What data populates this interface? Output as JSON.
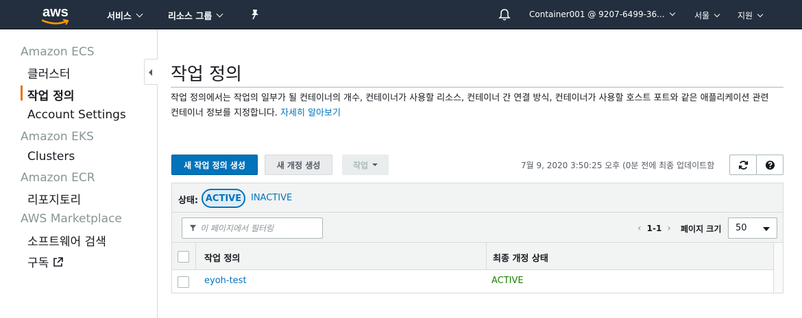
{
  "topnav": {
    "logo_text": "aws",
    "services_label": "서비스",
    "resource_groups_label": "리소스 그룹",
    "account_label": "Container001 @ 9207-6499-36...",
    "region_label": "서울",
    "support_label": "지원",
    "icons": [
      "pin-icon",
      "bell-icon"
    ]
  },
  "sidebar": {
    "sections": [
      {
        "heading": "Amazon ECS",
        "items": [
          "클러스터",
          "작업 정의",
          "Account Settings"
        ]
      },
      {
        "heading": "Amazon EKS",
        "items": [
          "Clusters"
        ]
      },
      {
        "heading": "Amazon ECR",
        "items": [
          "리포지토리"
        ]
      },
      {
        "heading": "AWS Marketplace",
        "items": [
          "소프트웨어 검색",
          "구독"
        ]
      }
    ],
    "active_item": "작업 정의"
  },
  "main": {
    "title": "작업 정의",
    "description": "작업 정의에서는 작업의 일부가 될 컨테이너의 개수, 컨테이너가 사용할 리소스, 컨테이너 간 연결 방식, 컨테이너가 사용할 호스트 포트와 같은 애플리케이션 관련 컨테이너 정보를 지정합니다.",
    "learn_more": "자세히 알아보기",
    "create_button": "새 작업 정의 생성",
    "new_revision_button": "새 개정 생성",
    "actions_button": "작업",
    "last_updated": "7월 9, 2020 3:50:25 오후 (0분 전에 최종 업데이트함",
    "status_label": "상태:",
    "status_active": "ACTIVE",
    "status_inactive": "INACTIVE",
    "filter_placeholder": "이 페이지에서 필터링",
    "pager_range": "1-1",
    "page_size_label": "페이지 크기",
    "page_size_value": "50",
    "columns": [
      "작업 정의",
      "최종 개정 상태"
    ],
    "rows": [
      {
        "name": "eyoh-test",
        "status": "ACTIVE"
      }
    ]
  },
  "colors": {
    "nav_bg": "#232f3e",
    "primary": "#0073bb",
    "accent": "#ec7211",
    "success": "#1d8102"
  }
}
